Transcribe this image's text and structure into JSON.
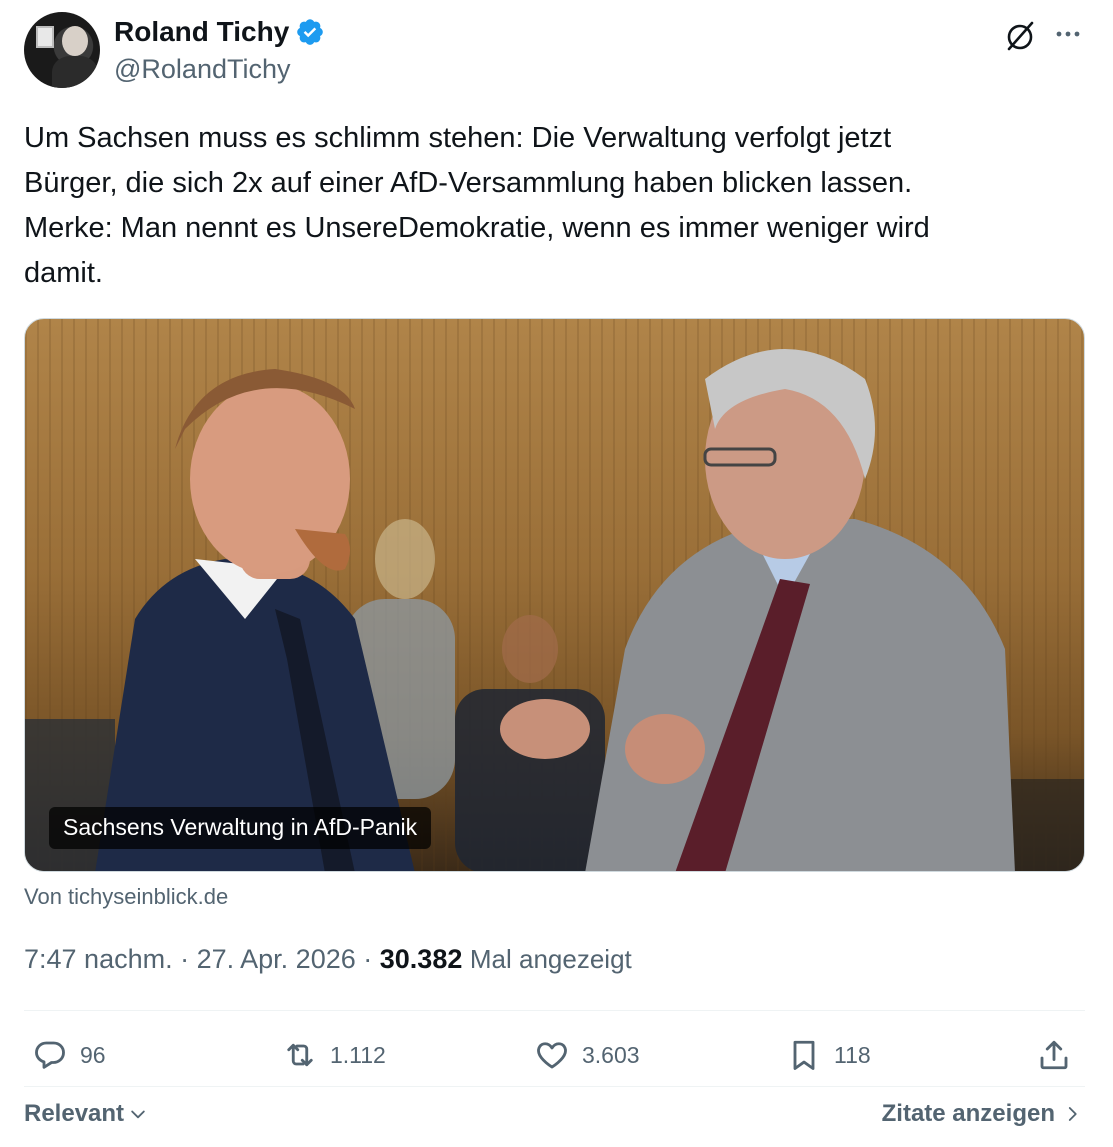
{
  "author": {
    "name": "Roland Tichy",
    "handle": "@RolandTichy"
  },
  "tweet": {
    "lines": [
      "Um Sachsen muss es schlimm stehen: Die Verwaltung verfolgt jetzt",
      "Bürger, die sich 2x auf einer AfD-Versammlung haben blicken lassen.",
      "Merke: Man nennt es UnsereDemokratie, wenn es immer weniger wird",
      "damit."
    ]
  },
  "media": {
    "caption": "Sachsens Verwaltung in AfD-Panik",
    "source": "Von tichyseinblick.de"
  },
  "meta": {
    "time": "7:47 nachm.",
    "date": "27. Apr. 2026",
    "views_count": "30.382",
    "views_label": "Mal angezeigt"
  },
  "actions": {
    "replies": "96",
    "reposts": "1.112",
    "likes": "3.603",
    "bookmarks": "118"
  },
  "footer": {
    "sort_label": "Relevant",
    "quotes_label": "Zitate anzeigen"
  },
  "colors": {
    "verified": "#1d9bf0",
    "secondary_text": "#536471",
    "primary_text": "#0f1419"
  },
  "icons": [
    "verified-badge-icon",
    "grok-icon",
    "more-icon",
    "reply-icon",
    "repost-icon",
    "like-icon",
    "bookmark-icon",
    "share-icon",
    "chevron-down-icon",
    "chevron-right-icon"
  ]
}
